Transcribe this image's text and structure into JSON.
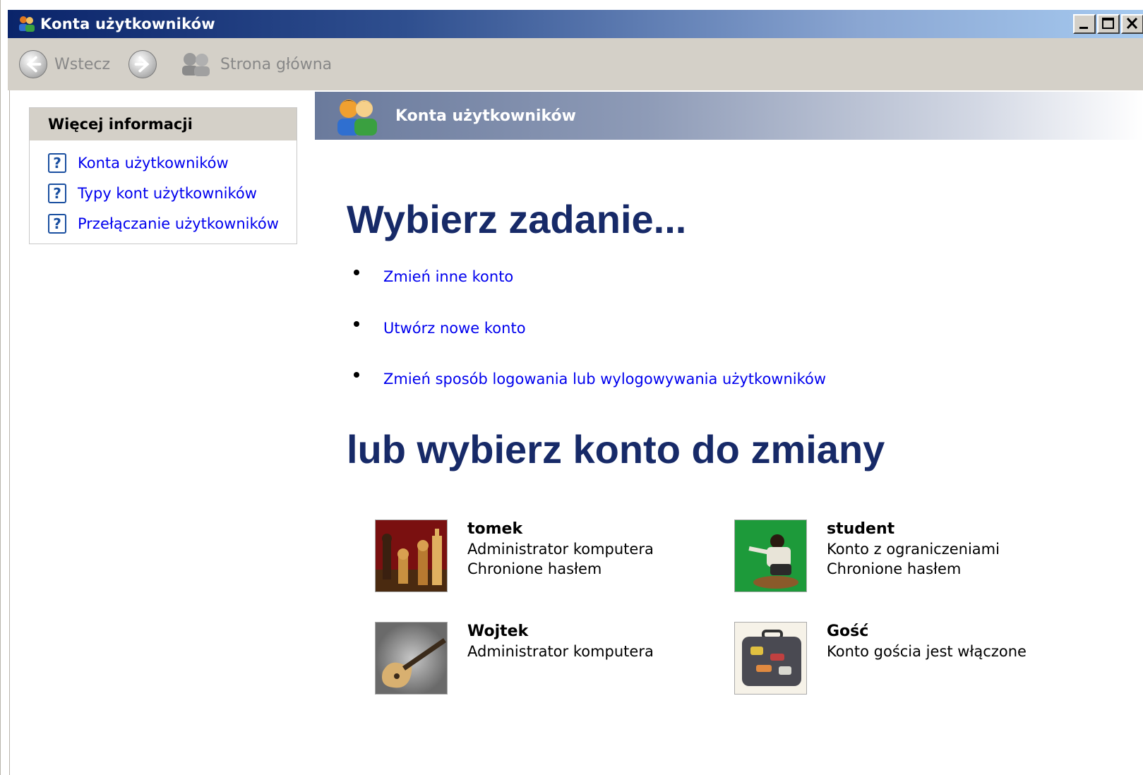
{
  "window": {
    "title": "Konta użytkowników"
  },
  "toolbar": {
    "back_label": "Wstecz",
    "home_label": "Strona główna"
  },
  "sidebar": {
    "heading": "Więcej informacji",
    "items": [
      {
        "label": "Konta użytkowników"
      },
      {
        "label": "Typy kont użytkowników"
      },
      {
        "label": "Przełączanie użytkowników"
      }
    ]
  },
  "banner": {
    "title": "Konta użytkowników"
  },
  "main": {
    "heading_tasks": "Wybierz zadanie...",
    "tasks": [
      {
        "label": "Zmień inne konto"
      },
      {
        "label": "Utwórz nowe konto"
      },
      {
        "label": "Zmień sposób logowania lub wylogowywania użytkowników"
      }
    ],
    "heading_accounts": "lub wybierz konto do zmiany",
    "accounts": [
      {
        "name": "tomek",
        "line1": "Administrator komputera",
        "line2": "Chronione hasłem",
        "picture": "chess-picture"
      },
      {
        "name": "student",
        "line1": "Konto z ograniczeniami",
        "line2": "Chronione hasłem",
        "picture": "skateboarder-picture"
      },
      {
        "name": "Wojtek",
        "line1": "Administrator komputera",
        "line2": "",
        "picture": "guitar-picture"
      },
      {
        "name": "Gość",
        "line1": "Konto gościa jest włączone",
        "line2": "",
        "picture": "suitcase-picture"
      }
    ]
  },
  "colors": {
    "heading": "#172a68",
    "link": "#0000ee",
    "titlebar_start": "#0a246a",
    "chrome": "#d4d0c8"
  }
}
